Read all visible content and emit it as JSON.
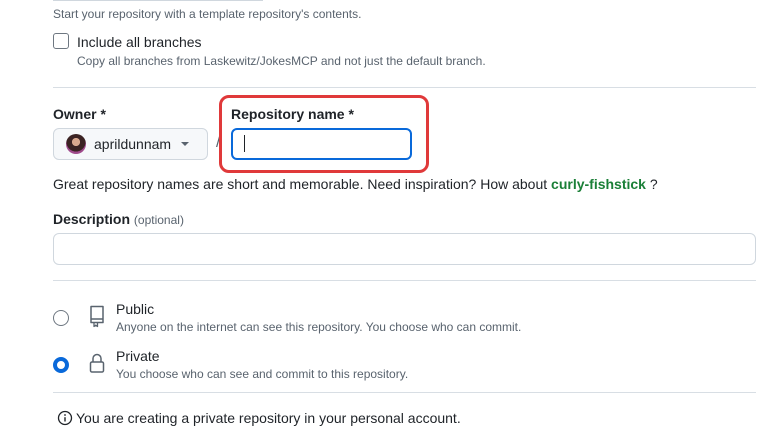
{
  "template": {
    "hint": "Start your repository with a template repository's contents.",
    "include_all_branches_label": "Include all branches",
    "include_all_branches_hint": "Copy all branches from Laskewitz/JokesMCP and not just the default branch.",
    "include_all_branches_checked": false
  },
  "owner": {
    "label": "Owner *",
    "value": "aprildunnam"
  },
  "separator": "/",
  "repository_name": {
    "label": "Repository name *",
    "value": ""
  },
  "name_hint": {
    "prefix": "Great repository names are short and memorable. Need inspiration? How about",
    "suggestion": "curly-fishstick",
    "suffix": " ?"
  },
  "description": {
    "label": "Description",
    "optional": "(optional)",
    "value": ""
  },
  "visibility": {
    "selected": "private",
    "public": {
      "title": "Public",
      "description": "Anyone on the internet can see this repository. You choose who can commit."
    },
    "private": {
      "title": "Private",
      "description": "You choose who can see and commit to this repository."
    }
  },
  "info": {
    "text": "You are creating a private repository in your personal account."
  },
  "colors": {
    "accent": "#0969da",
    "suggestion": "#1a7f37",
    "highlight": "#e0393a"
  },
  "icons": {
    "owner_dropdown": "chevron-down-icon",
    "public": "repo-icon",
    "private": "lock-icon",
    "info": "info-icon"
  }
}
